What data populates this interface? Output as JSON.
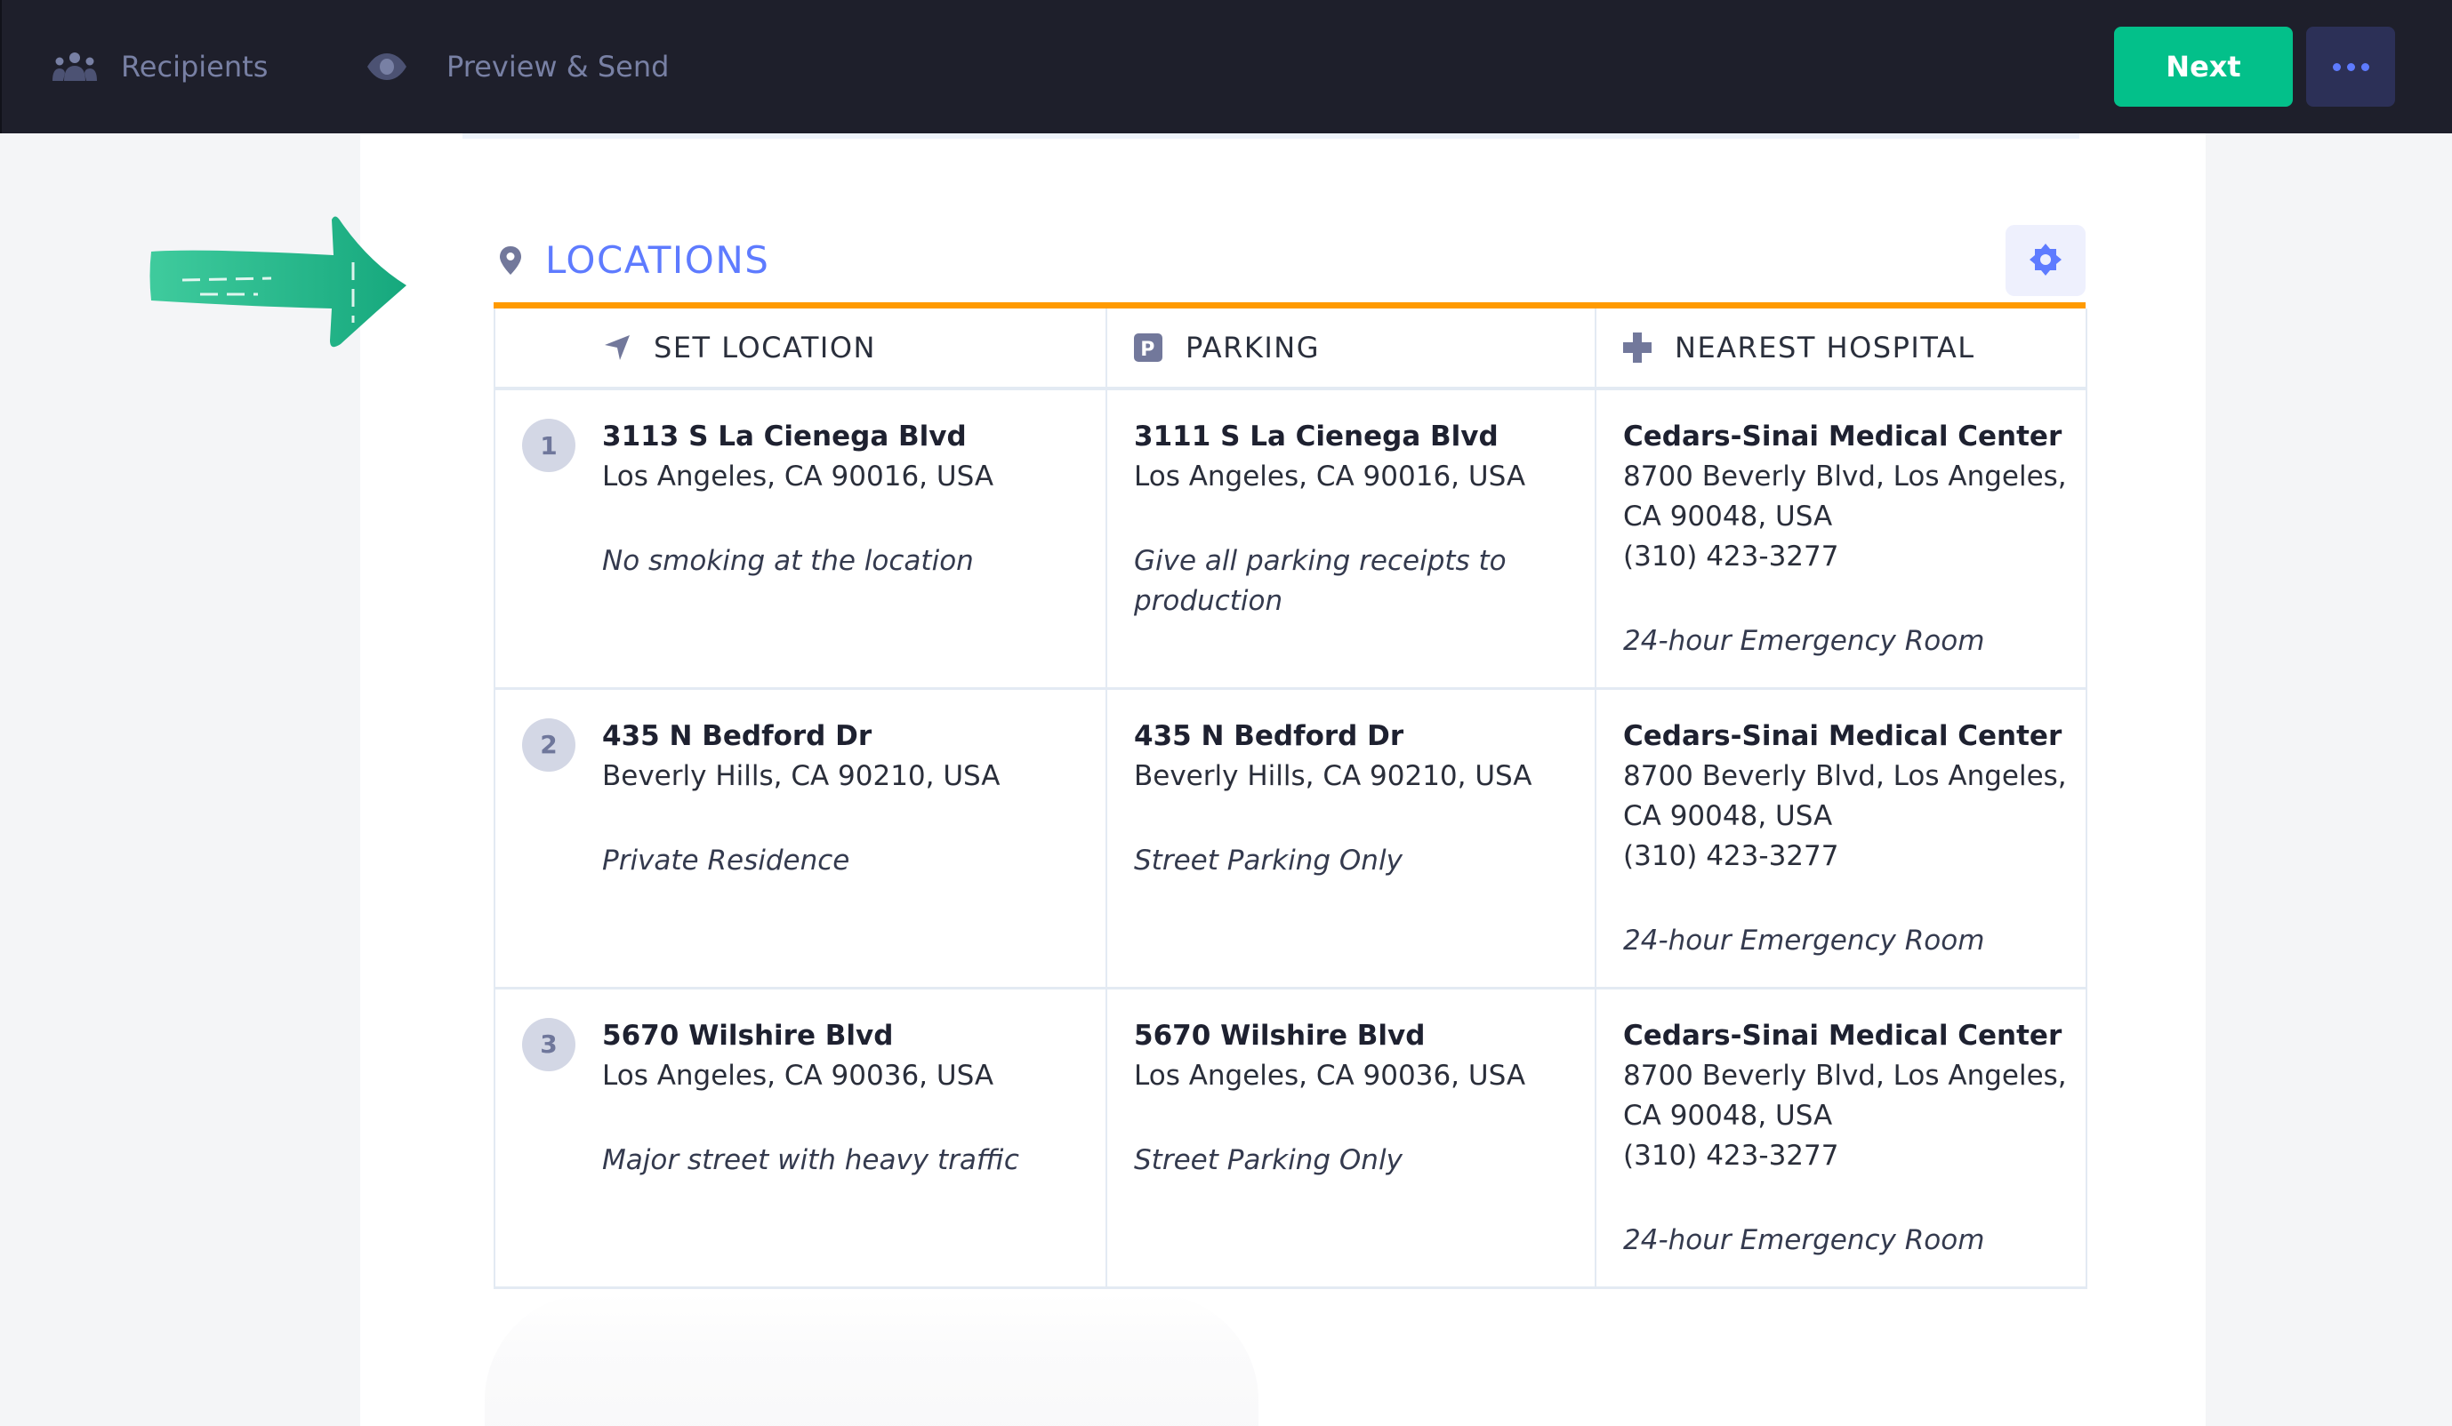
{
  "topbar": {
    "nav": [
      {
        "label": "Recipients",
        "icon": "users-icon"
      },
      {
        "label": "Preview & Send",
        "icon": "eye-icon"
      }
    ],
    "next_label": "Next",
    "more_icon": "ellipsis-icon"
  },
  "colors": {
    "topbar_bg": "#1e1f2b",
    "accent_blue": "#5e7bff",
    "next_green": "#03c08a",
    "section_rule": "#ff9a00",
    "annotation_arrow": "#1fb38a"
  },
  "section": {
    "title": "LOCATIONS",
    "title_icon": "map-pin-icon",
    "settings_icon": "gear-icon"
  },
  "table": {
    "columns": [
      {
        "label": "SET LOCATION",
        "icon": "navigation-arrow-icon"
      },
      {
        "label": "PARKING",
        "icon": "parking-icon"
      },
      {
        "label": "NEAREST HOSPITAL",
        "icon": "medical-cross-icon"
      }
    ],
    "rows": [
      {
        "number": "1",
        "location": {
          "line1": "3113 S La Cienega Blvd",
          "line2": "Los Angeles, CA 90016, USA",
          "note": "No smoking at the location"
        },
        "parking": {
          "line1": "3111 S La Cienega Blvd",
          "line2": "Los Angeles, CA 90016, USA",
          "note": "Give all parking receipts to production"
        },
        "hospital": {
          "name": "Cedars-Sinai Medical Center",
          "address": "8700 Beverly Blvd, Los Angeles, CA 90048, USA",
          "phone": "(310) 423-3277",
          "note": "24-hour Emergency Room"
        }
      },
      {
        "number": "2",
        "location": {
          "line1": "435 N Bedford Dr",
          "line2": "Beverly Hills, CA 90210, USA",
          "note": "Private Residence"
        },
        "parking": {
          "line1": "435 N Bedford Dr",
          "line2": "Beverly Hills, CA 90210, USA",
          "note": "Street Parking Only"
        },
        "hospital": {
          "name": "Cedars-Sinai Medical Center",
          "address": "8700 Beverly Blvd, Los Angeles, CA 90048, USA",
          "phone": "(310) 423-3277",
          "note": "24-hour Emergency Room"
        }
      },
      {
        "number": "3",
        "location": {
          "line1": "5670 Wilshire Blvd",
          "line2": "Los Angeles, CA 90036, USA",
          "note": "Major street with heavy traffic"
        },
        "parking": {
          "line1": "5670 Wilshire Blvd",
          "line2": "Los Angeles, CA 90036, USA",
          "note": "Street Parking Only"
        },
        "hospital": {
          "name": "Cedars-Sinai Medical Center",
          "address": "8700 Beverly Blvd, Los Angeles, CA 90048, USA",
          "phone": "(310) 423-3277",
          "note": "24-hour Emergency Room"
        }
      }
    ]
  }
}
